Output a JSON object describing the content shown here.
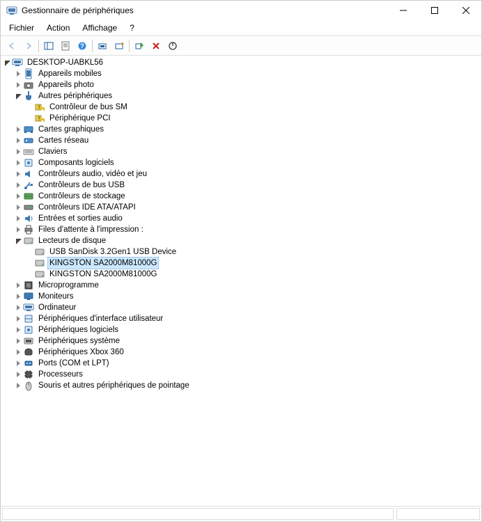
{
  "window": {
    "title": "Gestionnaire de périphériques"
  },
  "menu": {
    "file": "Fichier",
    "action": "Action",
    "view": "Affichage",
    "help": "?"
  },
  "tree": {
    "root": "DESKTOP-UABKL56",
    "cat": {
      "mobile": "Appareils mobiles",
      "camera": "Appareils photo",
      "other": "Autres périphériques",
      "other_smbus": "Contrôleur de bus SM",
      "other_pci": "Périphérique PCI",
      "display": "Cartes graphiques",
      "network": "Cartes réseau",
      "keyboard": "Claviers",
      "software": "Composants logiciels",
      "audioctrl": "Contrôleurs audio, vidéo et jeu",
      "usb": "Contrôleurs de bus USB",
      "storagectrl": "Contrôleurs de stockage",
      "ide": "Contrôleurs IDE ATA/ATAPI",
      "audioio": "Entrées et sorties audio",
      "printqueue": "Files d'attente à l'impression :",
      "disk": "Lecteurs de disque",
      "disk_usb": "USB  SanDisk 3.2Gen1 USB Device",
      "disk_k1": "KINGSTON SA2000M81000G",
      "disk_k2": "KINGSTON SA2000M81000G",
      "firmware": "Microprogramme",
      "monitor": "Moniteurs",
      "computer": "Ordinateur",
      "hid": "Périphériques d'interface utilisateur",
      "softdev": "Périphériques logiciels",
      "sysdev": "Périphériques système",
      "xbox": "Périphériques Xbox 360",
      "ports": "Ports (COM et LPT)",
      "cpu": "Processeurs",
      "mouse": "Souris et autres périphériques de pointage"
    }
  }
}
